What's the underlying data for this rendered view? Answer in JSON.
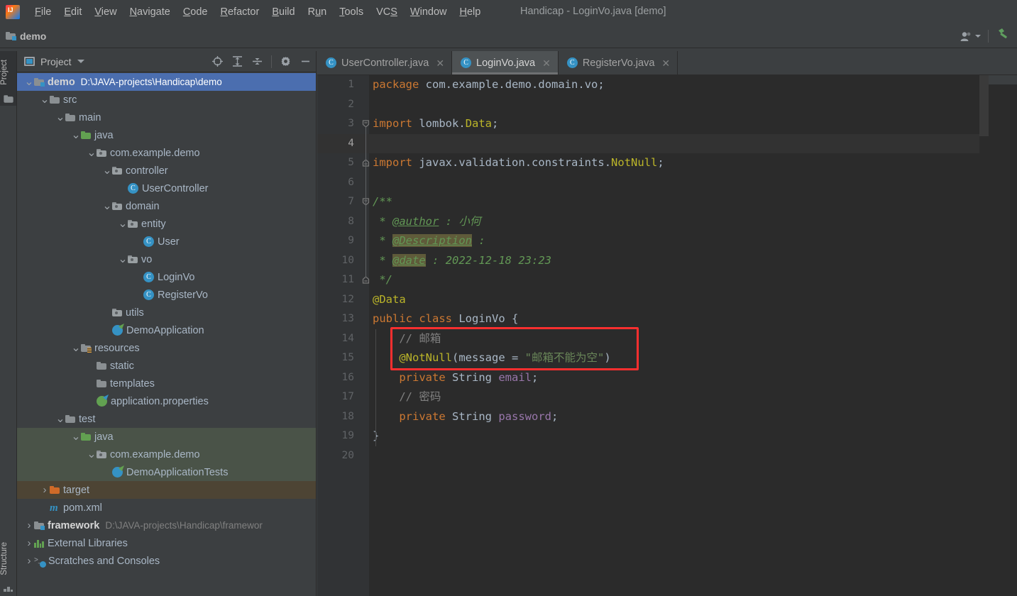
{
  "window": {
    "title": "Handicap - LoginVo.java [demo]",
    "logo_icon": "intellij-idea-logo"
  },
  "menubar": {
    "items": [
      {
        "label": "File",
        "mnemonic": "F"
      },
      {
        "label": "Edit",
        "mnemonic": "E"
      },
      {
        "label": "View",
        "mnemonic": "V"
      },
      {
        "label": "Navigate",
        "mnemonic": "N"
      },
      {
        "label": "Code",
        "mnemonic": "C"
      },
      {
        "label": "Refactor",
        "mnemonic": "R"
      },
      {
        "label": "Build",
        "mnemonic": "B"
      },
      {
        "label": "Run",
        "mnemonic": "u"
      },
      {
        "label": "Tools",
        "mnemonic": "T"
      },
      {
        "label": "VCS",
        "mnemonic": "S"
      },
      {
        "label": "Window",
        "mnemonic": "W"
      },
      {
        "label": "Help",
        "mnemonic": "H"
      }
    ]
  },
  "navbar": {
    "crumb": "demo",
    "crumb_icon": "module-folder-icon",
    "user_icon": "user-account-icon",
    "user_dropdown_icon": "chevron-down-icon",
    "build_icon": "hammer-build-icon"
  },
  "tool_strip": {
    "left_top": {
      "label": "Project",
      "icon": "project-folder-icon"
    },
    "left_bottom": {
      "label": "Structure",
      "icon": "structure-icon"
    }
  },
  "project_panel": {
    "title": "Project",
    "title_icon": "project-window-icon",
    "dropdown_icon": "chevron-down-icon",
    "tools": [
      {
        "name": "select-opened-file-icon",
        "tip": "Select Opened File"
      },
      {
        "name": "expand-all-icon",
        "tip": "Expand All"
      },
      {
        "name": "collapse-all-icon",
        "tip": "Collapse All"
      },
      {
        "name": "gear-settings-icon",
        "tip": "Settings"
      },
      {
        "name": "hide-panel-icon",
        "tip": "Hide"
      }
    ],
    "tree": [
      {
        "label": "demo",
        "path": "D:\\JAVA-projects\\Handicap\\demo",
        "indent": 0,
        "arrow": "down",
        "icon": "module-folder-icon",
        "state": "selected",
        "bold": true
      },
      {
        "label": "src",
        "indent": 1,
        "arrow": "down",
        "icon": "folder-icon"
      },
      {
        "label": "main",
        "indent": 2,
        "arrow": "down",
        "icon": "folder-icon"
      },
      {
        "label": "java",
        "indent": 3,
        "arrow": "down",
        "icon": "source-root-folder-icon"
      },
      {
        "label": "com.example.demo",
        "indent": 4,
        "arrow": "down",
        "icon": "package-icon"
      },
      {
        "label": "controller",
        "indent": 5,
        "arrow": "down",
        "icon": "package-icon"
      },
      {
        "label": "UserController",
        "indent": 6,
        "arrow": "none",
        "icon": "java-class-icon"
      },
      {
        "label": "domain",
        "indent": 5,
        "arrow": "down",
        "icon": "package-icon"
      },
      {
        "label": "entity",
        "indent": 6,
        "arrow": "down",
        "icon": "package-icon"
      },
      {
        "label": "User",
        "indent": 7,
        "arrow": "none",
        "icon": "java-class-icon"
      },
      {
        "label": "vo",
        "indent": 6,
        "arrow": "down",
        "icon": "package-icon"
      },
      {
        "label": "LoginVo",
        "indent": 7,
        "arrow": "none",
        "icon": "java-class-icon"
      },
      {
        "label": "RegisterVo",
        "indent": 7,
        "arrow": "none",
        "icon": "java-class-icon"
      },
      {
        "label": "utils",
        "indent": 5,
        "arrow": "none",
        "icon": "package-icon"
      },
      {
        "label": "DemoApplication",
        "indent": 5,
        "arrow": "none",
        "icon": "spring-boot-class-icon"
      },
      {
        "label": "resources",
        "indent": 3,
        "arrow": "down",
        "icon": "resources-root-folder-icon"
      },
      {
        "label": "static",
        "indent": 4,
        "arrow": "none",
        "icon": "folder-icon"
      },
      {
        "label": "templates",
        "indent": 4,
        "arrow": "none",
        "icon": "folder-icon"
      },
      {
        "label": "application.properties",
        "indent": 4,
        "arrow": "none",
        "icon": "spring-properties-icon"
      },
      {
        "label": "test",
        "indent": 2,
        "arrow": "down",
        "icon": "folder-icon"
      },
      {
        "label": "java",
        "indent": 3,
        "arrow": "down",
        "icon": "test-source-root-folder-icon",
        "state": "test-root"
      },
      {
        "label": "com.example.demo",
        "indent": 4,
        "arrow": "down",
        "icon": "package-icon",
        "state": "test-root"
      },
      {
        "label": "DemoApplicationTests",
        "indent": 5,
        "arrow": "none",
        "icon": "spring-boot-test-class-icon",
        "state": "test-root"
      },
      {
        "label": "target",
        "indent": 1,
        "arrow": "right",
        "icon": "excluded-folder-icon",
        "state": "target-root"
      },
      {
        "label": "pom.xml",
        "indent": 1,
        "arrow": "none",
        "icon": "maven-icon"
      },
      {
        "label": "framework",
        "path": "D:\\JAVA-projects\\Handicap\\framewor",
        "indent": 0,
        "arrow": "right",
        "icon": "module-folder-icon",
        "bold": true
      },
      {
        "label": "External Libraries",
        "indent": 0,
        "arrow": "right",
        "icon": "libraries-icon"
      },
      {
        "label": "Scratches and Consoles",
        "indent": 0,
        "arrow": "right",
        "icon": "scratches-icon"
      }
    ]
  },
  "editor": {
    "tabs": [
      {
        "label": "UserController.java",
        "icon": "java-class-icon",
        "close_icon": "close-icon",
        "active": false
      },
      {
        "label": "LoginVo.java",
        "icon": "java-class-icon",
        "close_icon": "close-icon",
        "active": true
      },
      {
        "label": "RegisterVo.java",
        "icon": "java-class-icon",
        "close_icon": "close-icon",
        "active": false
      }
    ],
    "caret_line": 4,
    "total_lines": 20,
    "highlight_box": {
      "color": "#fc2f2f",
      "from_line": 14,
      "to_line": 15
    },
    "lines": [
      {
        "n": 1,
        "text": "package com.example.demo.domain.vo;"
      },
      {
        "n": 2,
        "text": ""
      },
      {
        "n": 3,
        "text": "import lombok.Data;"
      },
      {
        "n": 4,
        "text": ""
      },
      {
        "n": 5,
        "text": "import javax.validation.constraints.NotNull;"
      },
      {
        "n": 6,
        "text": ""
      },
      {
        "n": 7,
        "text": "/**"
      },
      {
        "n": 8,
        "text": " * @author : 小何"
      },
      {
        "n": 9,
        "text": " * @Description :"
      },
      {
        "n": 10,
        "text": " * @date : 2022-12-18 23:23"
      },
      {
        "n": 11,
        "text": " */"
      },
      {
        "n": 12,
        "text": "@Data"
      },
      {
        "n": 13,
        "text": "public class LoginVo {"
      },
      {
        "n": 14,
        "text": "    // 邮箱"
      },
      {
        "n": 15,
        "text": "    @NotNull(message = \"邮箱不能为空\")"
      },
      {
        "n": 16,
        "text": "    private String email;"
      },
      {
        "n": 17,
        "text": "    // 密码"
      },
      {
        "n": 18,
        "text": "    private String password;"
      },
      {
        "n": 19,
        "text": "}"
      },
      {
        "n": 20,
        "text": ""
      }
    ]
  },
  "colors": {
    "panel_bg": "#3c3f41",
    "editor_bg": "#2b2b2b",
    "gutter_bg": "#313335",
    "selection_blue": "#4b6eaf",
    "test_root_green": "#4a5348",
    "target_root_brown": "#4d4434",
    "highlight_red": "#fc2f2f",
    "keyword_orange": "#cc7832",
    "string_green": "#6a8759",
    "annotation_yellow": "#bbb529",
    "comment_gray": "#808080",
    "javadoc_green": "#629755",
    "field_purple": "#9876aa",
    "text_default": "#a9b7c6"
  }
}
